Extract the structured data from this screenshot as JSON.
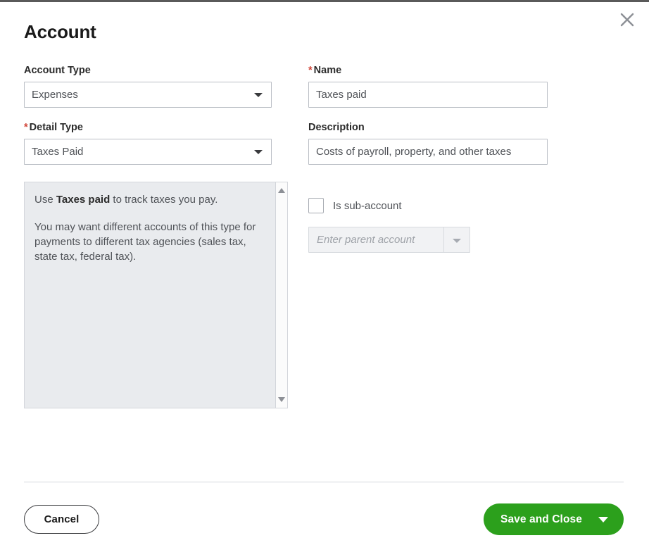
{
  "window": {
    "title": "Account",
    "close_icon": "close-x-icon"
  },
  "form": {
    "account_type": {
      "label": "Account Type",
      "required": false,
      "value": "Expenses",
      "caret_icon": "chevron-down-icon"
    },
    "detail_type": {
      "label": "Detail Type",
      "required": true,
      "required_marker": "*",
      "value": "Taxes Paid",
      "caret_icon": "chevron-down-icon"
    },
    "name": {
      "label": "Name",
      "required": true,
      "required_marker": "*",
      "value": "Taxes paid"
    },
    "description": {
      "label": "Description",
      "required": false,
      "value": "Costs of payroll, property, and other taxes"
    },
    "is_sub_account": {
      "label": "Is sub-account",
      "checked": false
    },
    "parent_account": {
      "placeholder": "Enter parent account",
      "value": "",
      "disabled": true,
      "caret_icon": "chevron-down-icon"
    }
  },
  "info_panel": {
    "paragraph_1_prefix": "Use ",
    "paragraph_1_bold": "Taxes paid",
    "paragraph_1_suffix": " to track taxes you pay.",
    "paragraph_2": "You may want different accounts of this type for payments to different tax agencies (sales tax, state tax, federal tax).",
    "scroll_up_icon": "scroll-up-arrow-icon",
    "scroll_down_icon": "scroll-down-arrow-icon"
  },
  "footer": {
    "cancel_label": "Cancel",
    "save_label": "Save and Close",
    "save_caret_icon": "chevron-down-icon"
  },
  "colors": {
    "primary_green": "#2ca01c",
    "required_red": "#d04437",
    "info_bg": "#e9ebee",
    "border": "#babec5",
    "text": "#393a3d"
  }
}
